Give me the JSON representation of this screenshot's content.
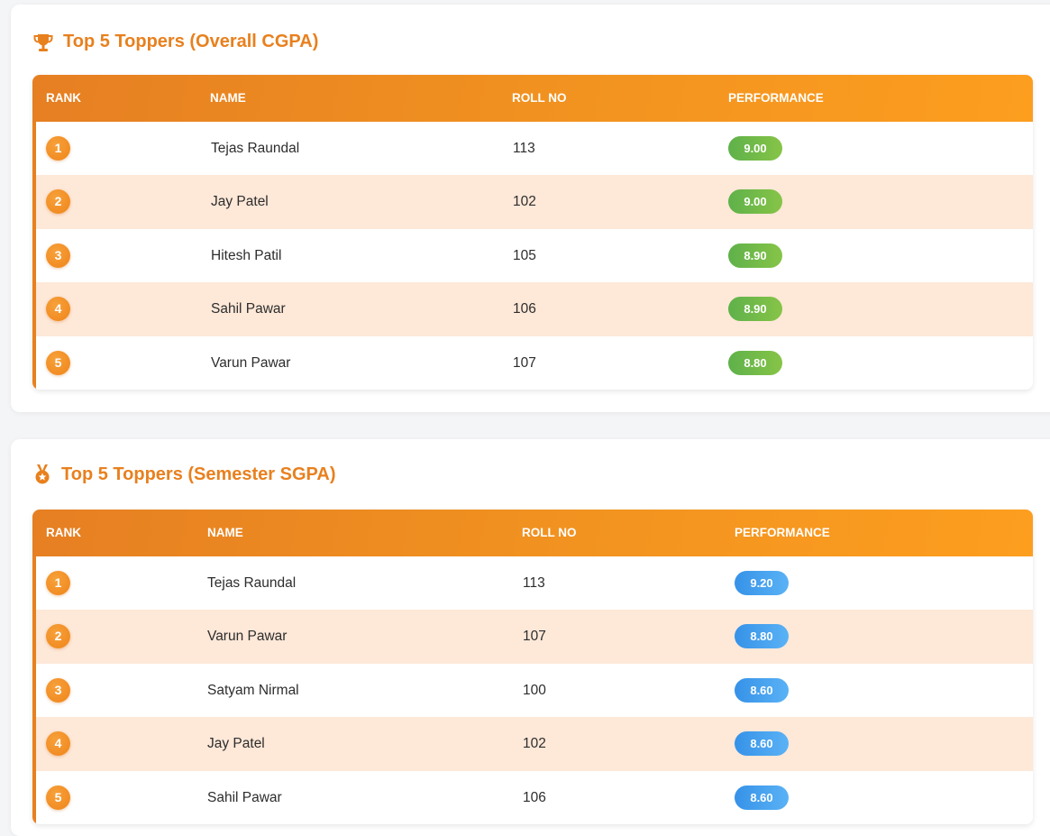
{
  "cgpa_section": {
    "title": "Top 5 Toppers (Overall CGPA)",
    "icon": "trophy-icon",
    "columns": [
      "RANK",
      "NAME",
      "ROLL NO",
      "PERFORMANCE"
    ],
    "rows": [
      {
        "rank": "1",
        "name": "Tejas Raundal",
        "roll": "113",
        "score": "9.00"
      },
      {
        "rank": "2",
        "name": "Jay Patel",
        "roll": "102",
        "score": "9.00"
      },
      {
        "rank": "3",
        "name": "Hitesh Patil",
        "roll": "105",
        "score": "8.90"
      },
      {
        "rank": "4",
        "name": "Sahil Pawar",
        "roll": "106",
        "score": "8.90"
      },
      {
        "rank": "5",
        "name": "Varun Pawar",
        "roll": "107",
        "score": "8.80"
      }
    ],
    "pill_color": "#6ab84a"
  },
  "sgpa_section": {
    "title": "Top 5 Toppers (Semester SGPA)",
    "icon": "medal-icon",
    "columns": [
      "RANK",
      "NAME",
      "ROLL NO",
      "PERFORMANCE"
    ],
    "rows": [
      {
        "rank": "1",
        "name": "Tejas Raundal",
        "roll": "113",
        "score": "9.20"
      },
      {
        "rank": "2",
        "name": "Varun Pawar",
        "roll": "107",
        "score": "8.80"
      },
      {
        "rank": "3",
        "name": "Satyam Nirmal",
        "roll": "100",
        "score": "8.60"
      },
      {
        "rank": "4",
        "name": "Jay Patel",
        "roll": "102",
        "score": "8.60"
      },
      {
        "rank": "5",
        "name": "Sahil Pawar",
        "roll": "106",
        "score": "8.60"
      }
    ],
    "pill_color": "#3f9ceb"
  },
  "colors": {
    "accent": "#e8801e",
    "row_alt": "#fee8d8"
  }
}
